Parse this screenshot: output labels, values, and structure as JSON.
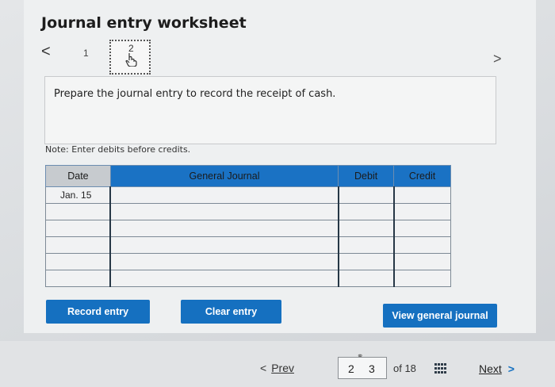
{
  "header": {
    "title": "Journal entry worksheet",
    "nav_left": "<",
    "nav_right": ">",
    "steps": [
      "1",
      "2"
    ]
  },
  "prompt": "Prepare the journal entry to record the receipt of cash.",
  "note": "Note: Enter debits before credits.",
  "table": {
    "headers": {
      "date": "Date",
      "general_journal": "General Journal",
      "debit": "Debit",
      "credit": "Credit"
    },
    "rows": [
      {
        "date": "Jan. 15",
        "account": "",
        "debit": "",
        "credit": ""
      },
      {
        "date": "",
        "account": "",
        "debit": "",
        "credit": ""
      },
      {
        "date": "",
        "account": "",
        "debit": "",
        "credit": ""
      },
      {
        "date": "",
        "account": "",
        "debit": "",
        "credit": ""
      },
      {
        "date": "",
        "account": "",
        "debit": "",
        "credit": ""
      },
      {
        "date": "",
        "account": "",
        "debit": "",
        "credit": ""
      }
    ]
  },
  "buttons": {
    "record": "Record entry",
    "clear": "Clear entry",
    "view": "View general journal"
  },
  "footer": {
    "prev_chev": "<",
    "prev": "Prev",
    "page_current": "2",
    "page_next": "3",
    "of_total": "of 18",
    "next": "Next",
    "next_chev": ">"
  },
  "colors": {
    "accent": "#1570c0",
    "header_bg": "#1a72c4"
  },
  "icons": {
    "step2": "hand-pointer-icon",
    "pages": "grid-icon",
    "link": "link-icon"
  }
}
